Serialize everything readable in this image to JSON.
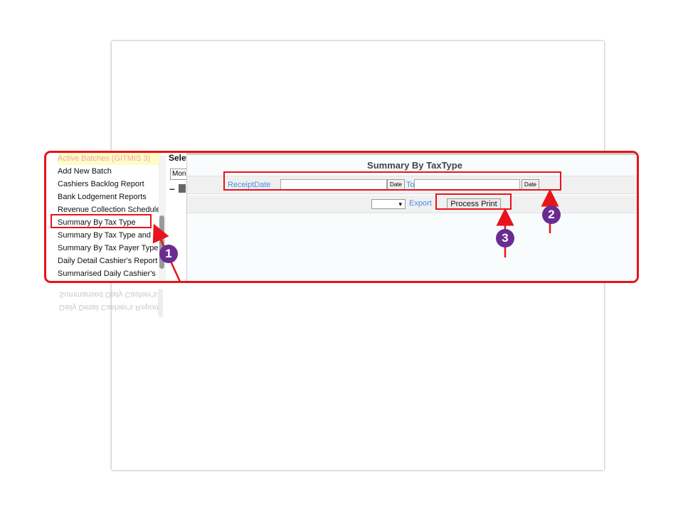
{
  "menu": {
    "items": [
      "Active Batches (GITMIS 3)",
      "Add New Batch",
      "Cashiers Backlog Report",
      "Bank Lodgement Reports",
      "Revenue Collection Schedule",
      "Summary By Tax Type",
      "Summary By Tax Type and",
      "Summary By Tax Payer Type",
      "Daily Detail Cashier's Report",
      "Summarised Daily Cashier's"
    ]
  },
  "middle": {
    "label": "Sele",
    "input_value": "Mon",
    "minus": "–"
  },
  "panel": {
    "title": "Summary By TaxType",
    "receipt_label": "ReceiptDate",
    "to_label": "To",
    "date_button": "Date",
    "export_label": "Export",
    "process_button": "Process Print",
    "select_value": "",
    "select_arrow": "▾"
  },
  "annotations": {
    "badge1": "1",
    "badge2": "2",
    "badge3": "3",
    "accent_color": "#e8131b",
    "badge_color": "#6a2c91"
  },
  "reflection": {
    "line1": "Summarised Daily Cashier's",
    "line2": "Daily Detail Cashier's Report"
  }
}
